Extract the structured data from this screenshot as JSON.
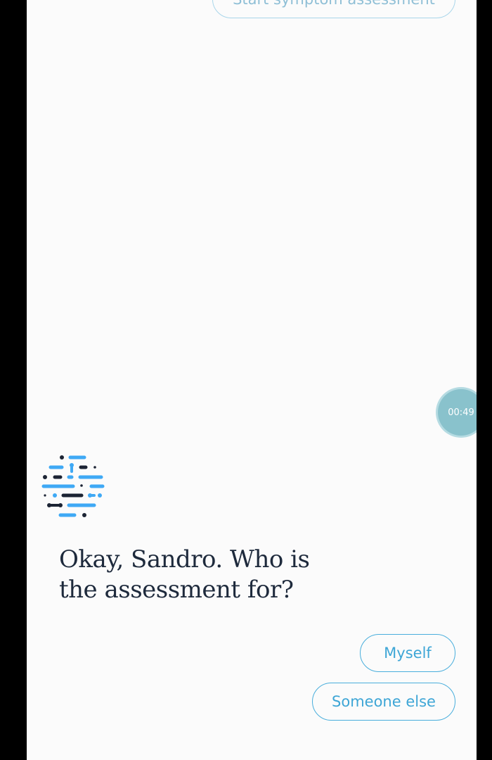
{
  "chat": {
    "previous_reply": "Start symptom assessment",
    "bot_message": "Okay, Sandro. Who is the assessment for?",
    "options": [
      {
        "label": "Myself"
      },
      {
        "label": "Someone else"
      }
    ]
  },
  "timer": {
    "label": "00:49"
  },
  "avatar": {
    "icon": "ada-bot-avatar-icon",
    "colors": {
      "blue": "#3fa9f5",
      "dark": "#1c2434"
    }
  },
  "colors": {
    "accent": "#3ea6d6",
    "timer_bg": "#89c2cc",
    "text": "#1e2a3c",
    "background": "#fbfbfb"
  }
}
